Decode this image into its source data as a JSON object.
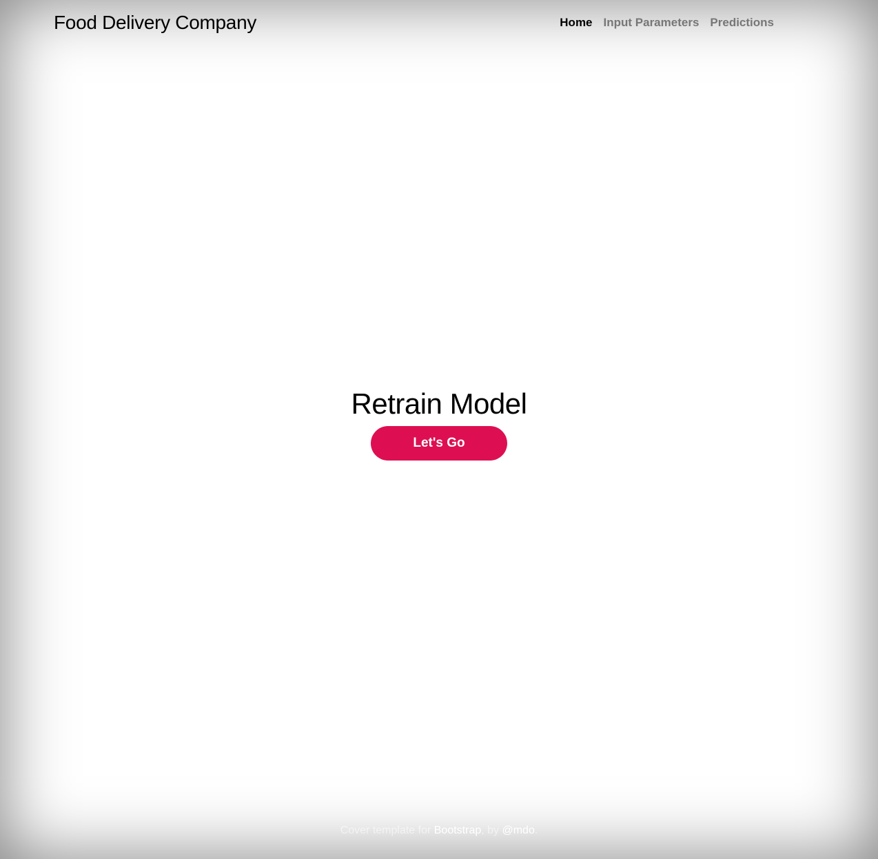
{
  "header": {
    "brand": "Food Delivery Company",
    "nav": [
      {
        "label": "Home",
        "active": true
      },
      {
        "label": "Input Parameters",
        "active": false
      },
      {
        "label": "Predictions",
        "active": false
      }
    ]
  },
  "main": {
    "heading": "Retrain Model",
    "button_label": "Let's Go",
    "button_color": "#dd0f52"
  },
  "footer": {
    "prefix": "Cover template for ",
    "link1": "Bootstrap",
    "middle": ", by ",
    "link2": "@mdo",
    "suffix": "."
  }
}
